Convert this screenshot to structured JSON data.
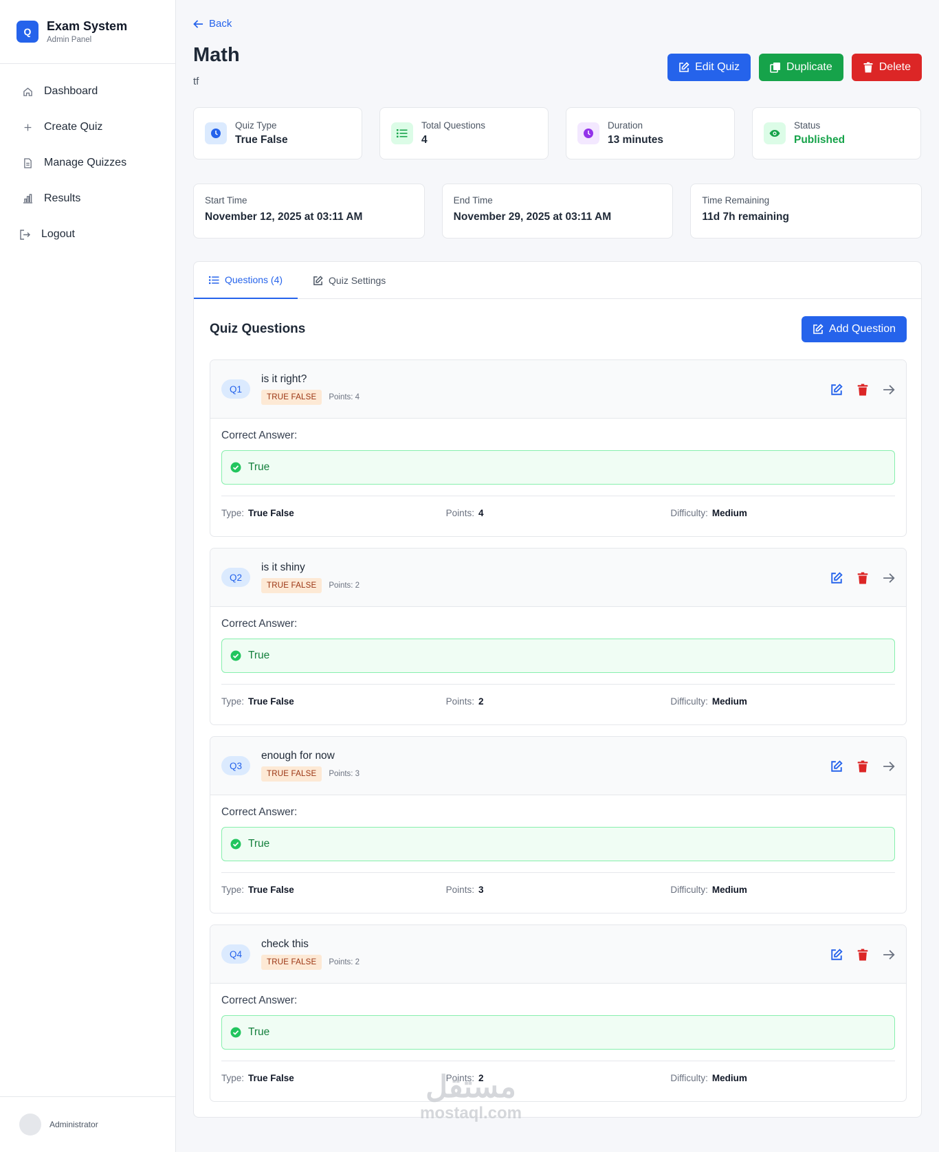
{
  "brand": {
    "logo_letter": "Q",
    "title": "Exam System",
    "subtitle": "Admin Panel"
  },
  "nav": [
    {
      "label": "Dashboard",
      "icon": "home-icon"
    },
    {
      "label": "Create Quiz",
      "icon": "plus-icon"
    },
    {
      "label": "Manage Quizzes",
      "icon": "file-icon"
    },
    {
      "label": "Results",
      "icon": "bar-chart-icon"
    },
    {
      "label": "Logout",
      "icon": "logout-icon"
    }
  ],
  "user": {
    "name": "Administrator"
  },
  "header": {
    "back_label": "Back",
    "title": "Math",
    "subtitle": "tf",
    "edit_label": "Edit Quiz",
    "duplicate_label": "Duplicate",
    "delete_label": "Delete"
  },
  "stats": [
    {
      "label": "Quiz Type",
      "value": "True False",
      "icon": "clock-icon",
      "color": "#2563eb"
    },
    {
      "label": "Total Questions",
      "value": "4",
      "icon": "list-icon",
      "color": "#16a34a"
    },
    {
      "label": "Duration",
      "value": "13 minutes",
      "icon": "clock-icon",
      "color": "#9333ea"
    },
    {
      "label": "Status",
      "value": "Published",
      "icon": "eye-icon",
      "color": "#16a34a"
    }
  ],
  "times": [
    {
      "label": "Start Time",
      "value": "November 12, 2025 at 03:11 AM"
    },
    {
      "label": "End Time",
      "value": "November 29, 2025 at 03:11 AM"
    },
    {
      "label": "Time Remaining",
      "value": "11d 7h remaining"
    }
  ],
  "tabs": {
    "questions": "Questions (4)",
    "settings": "Quiz Settings"
  },
  "section": {
    "title": "Quiz Questions",
    "add_label": "Add Question"
  },
  "labels": {
    "correct_answer": "Correct Answer:",
    "type": "Type:",
    "points": "Points:",
    "difficulty": "Difficulty:"
  },
  "questions": [
    {
      "badge": "Q1",
      "text": "is it right?",
      "type_tag": "TRUE FALSE",
      "points_text": "Points: 4",
      "answer": "True",
      "type": "True False",
      "points": "4",
      "difficulty": "Medium"
    },
    {
      "badge": "Q2",
      "text": "is it shiny",
      "type_tag": "TRUE FALSE",
      "points_text": "Points: 2",
      "answer": "True",
      "type": "True False",
      "points": "2",
      "difficulty": "Medium"
    },
    {
      "badge": "Q3",
      "text": "enough for now",
      "type_tag": "TRUE FALSE",
      "points_text": "Points: 3",
      "answer": "True",
      "type": "True False",
      "points": "3",
      "difficulty": "Medium"
    },
    {
      "badge": "Q4",
      "text": "check this",
      "type_tag": "TRUE FALSE",
      "points_text": "Points: 2",
      "answer": "True",
      "type": "True False",
      "points": "2",
      "difficulty": "Medium"
    }
  ],
  "watermark": {
    "arabic": "مستقل",
    "latin": "mostaql.com"
  },
  "colors": {
    "primary": "#2563eb",
    "success": "#16a34a",
    "danger": "#dc2626",
    "purple": "#9333ea",
    "tag_bg": "#fde9d5"
  }
}
